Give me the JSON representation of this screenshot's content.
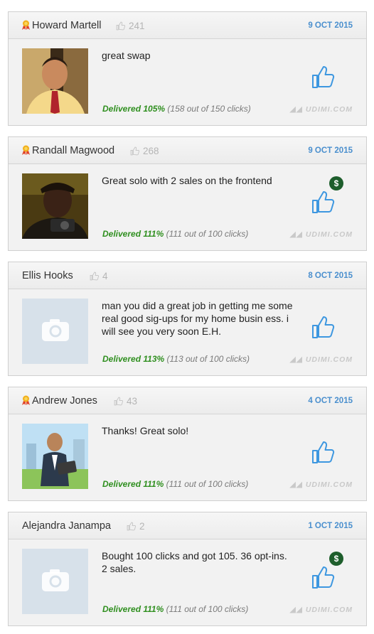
{
  "reviews": [
    {
      "name": "Howard Martell",
      "likes": "241",
      "date": "9 OCT 2015",
      "message": "great swap",
      "delivered_pct": "Delivered 105%",
      "delivered_detail": "(158 out of 150 clicks)",
      "has_badge": true,
      "has_sale": false,
      "avatar": "photo-man-in-tie",
      "brand": "UDIMI.COM"
    },
    {
      "name": "Randall Magwood",
      "likes": "268",
      "date": "9 OCT 2015",
      "message": "Great solo with 2 sales on the frontend",
      "delivered_pct": "Delivered 111%",
      "delivered_detail": "(111 out of 100 clicks)",
      "has_badge": true,
      "has_sale": true,
      "sale_symbol": "$",
      "avatar": "photo-man-with-camera",
      "brand": "UDIMI.COM"
    },
    {
      "name": "Ellis Hooks",
      "likes": "4",
      "date": "8 OCT 2015",
      "message": "man you did a great job in getting me some real good sig-ups for my home busin ess. i will see you very soon E.H.",
      "delivered_pct": "Delivered 113%",
      "delivered_detail": "(113 out of 100 clicks)",
      "has_badge": false,
      "has_sale": false,
      "avatar": "camera-placeholder-icon",
      "brand": "UDIMI.COM"
    },
    {
      "name": "Andrew Jones",
      "likes": "43",
      "date": "4 OCT 2015",
      "message": "Thanks! Great solo!",
      "delivered_pct": "Delivered 111%",
      "delivered_detail": "(111 out of 100 clicks)",
      "has_badge": true,
      "has_sale": false,
      "avatar": "cartoon-man-with-laptop",
      "brand": "UDIMI.COM"
    },
    {
      "name": "Alejandra Janampa",
      "likes": "2",
      "date": "1 OCT 2015",
      "message": "Bought 100 clicks and got 105. 36 opt-ins. 2 sales.",
      "delivered_pct": "Delivered 111%",
      "delivered_detail": "(111 out of 100 clicks)",
      "has_badge": false,
      "has_sale": true,
      "sale_symbol": "$",
      "avatar": "camera-placeholder-icon",
      "brand": "UDIMI.COM"
    }
  ],
  "colors": {
    "date": "#4a8fce",
    "delivered": "#2f8f1f",
    "thumb": "#3d97e0",
    "sale": "#1e5e2c"
  }
}
